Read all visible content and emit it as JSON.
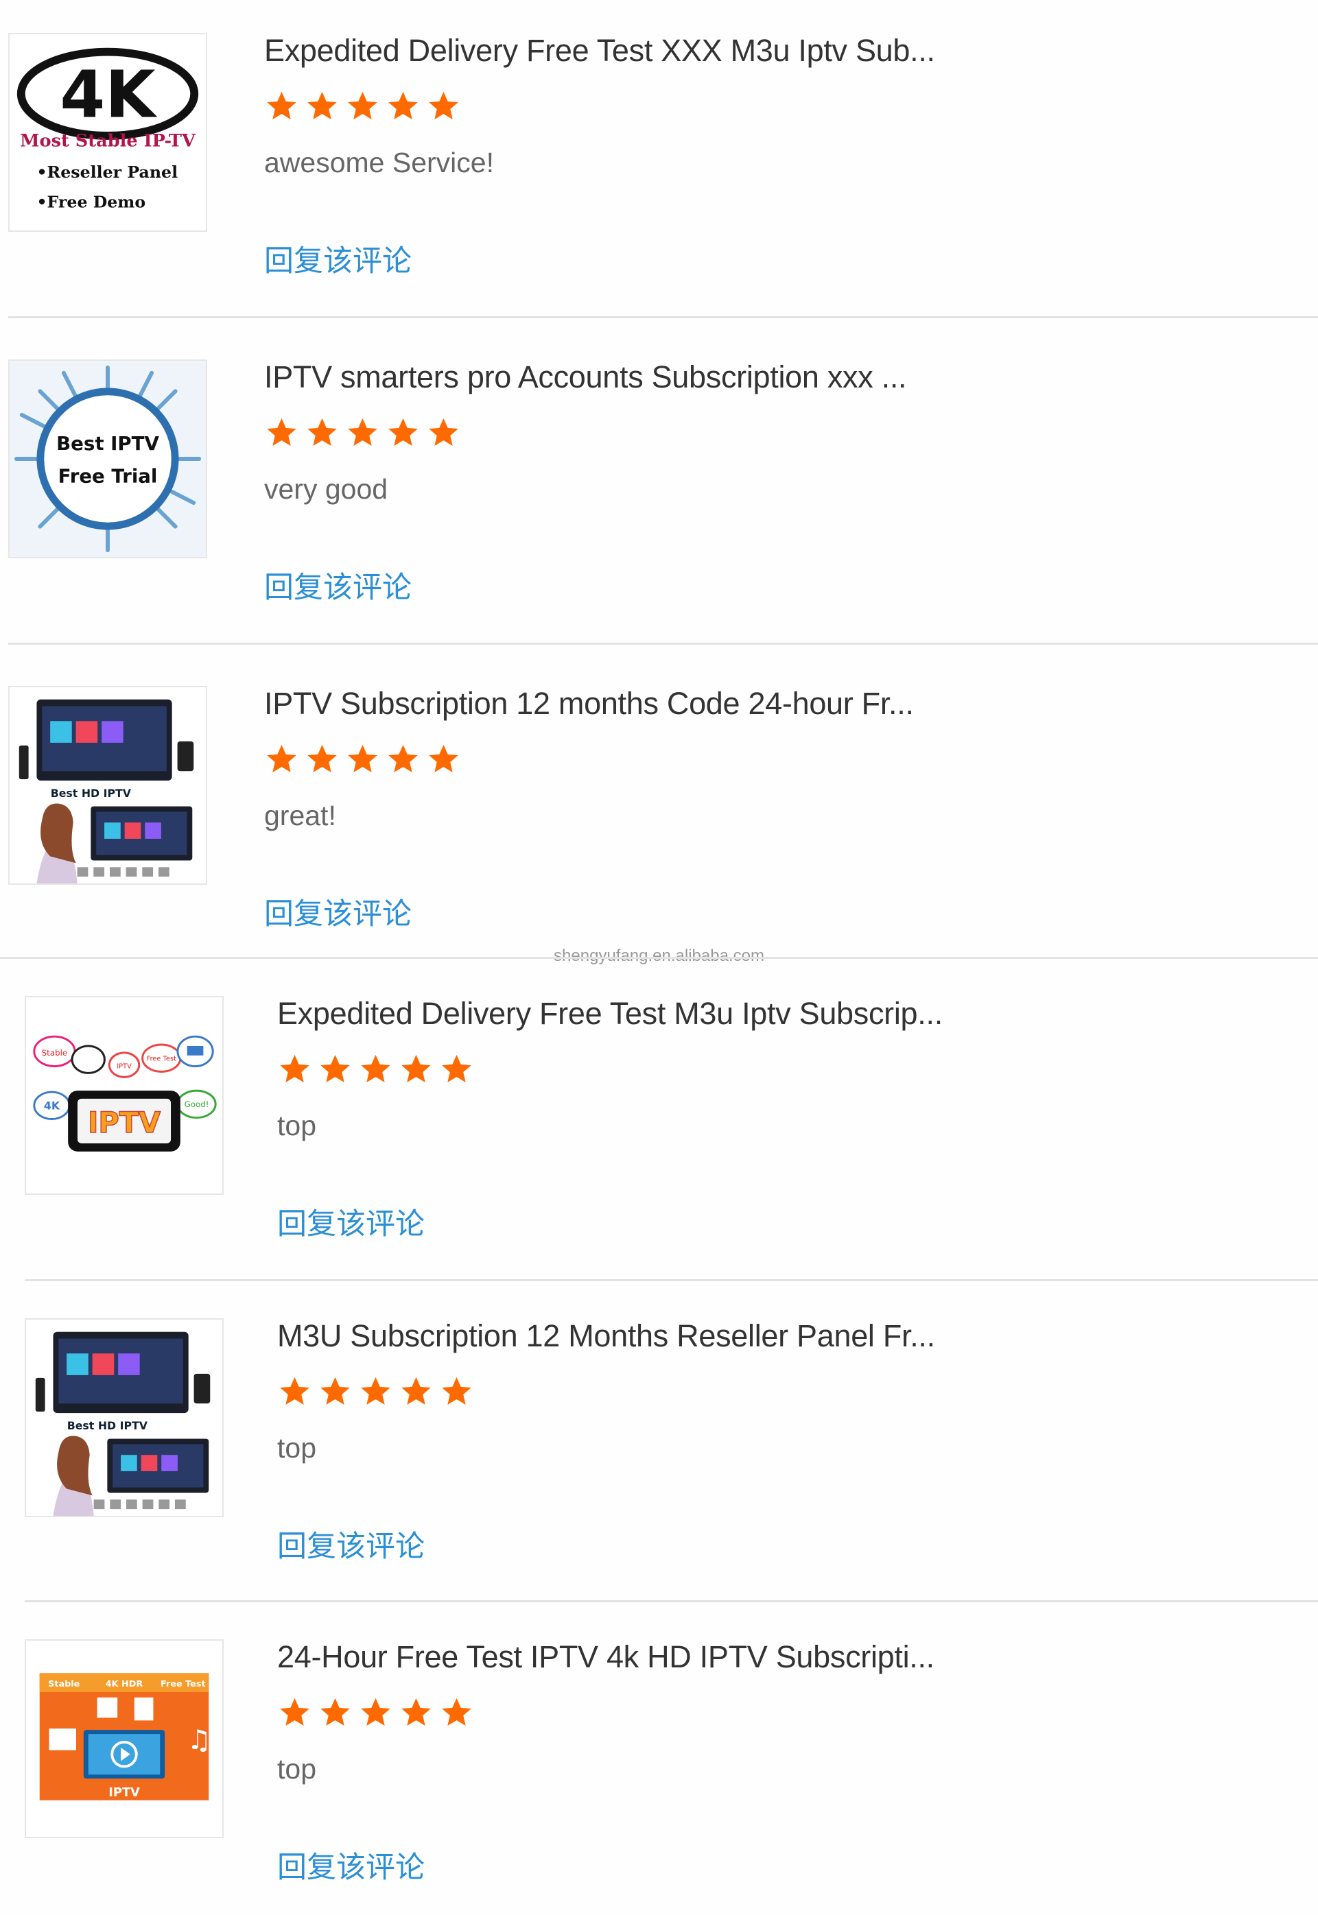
{
  "watermark": "shengyufang.en.alibaba.com",
  "accent_star_color": "#ff6a00",
  "link_color": "#2b8fd6",
  "reviews": [
    {
      "title": "Expedited Delivery Free Test XXX M3u Iptv Sub...",
      "rating": 5,
      "comment": "awesome Service!",
      "reply_label": "回复该评论",
      "thumb": {
        "big": "4K",
        "line1": "Most Stable IP-TV",
        "line2": "•Reseller Panel",
        "line3": "•Free Demo"
      }
    },
    {
      "title": "IPTV smarters pro Accounts Subscription xxx ...",
      "rating": 5,
      "comment": "very good",
      "reply_label": "回复该评论",
      "thumb": {
        "line1": "Best IPTV",
        "line2": "Free Trial"
      }
    },
    {
      "title": "IPTV Subscription 12 months Code 24-hour Fr...",
      "rating": 5,
      "comment": "great!",
      "reply_label": "回复该评论",
      "thumb": {
        "label": "Best HD IPTV"
      }
    },
    {
      "title": "Expedited Delivery Free Test M3u Iptv Subscrip...",
      "rating": 5,
      "comment": "top",
      "reply_label": "回复该评论",
      "thumb": {
        "screen": "IPTV",
        "tag1": "Stable",
        "tag2": "4K",
        "tag3": "Good!",
        "tag4": "IPTV",
        "tag5": "Free Test"
      }
    },
    {
      "title": "M3U Subscription 12 Months Reseller Panel Fr...",
      "rating": 5,
      "comment": "top",
      "reply_label": "回复该评论",
      "thumb": {
        "label": "Best HD IPTV"
      }
    },
    {
      "title": "24-Hour Free Test IPTV 4k HD IPTV Subscripti...",
      "rating": 5,
      "comment": "top",
      "reply_label": "回复该评论",
      "thumb": {
        "tag1": "Stable",
        "tag2": "4K HDR",
        "tag3": "Free Test",
        "label": "IPTV"
      }
    }
  ]
}
